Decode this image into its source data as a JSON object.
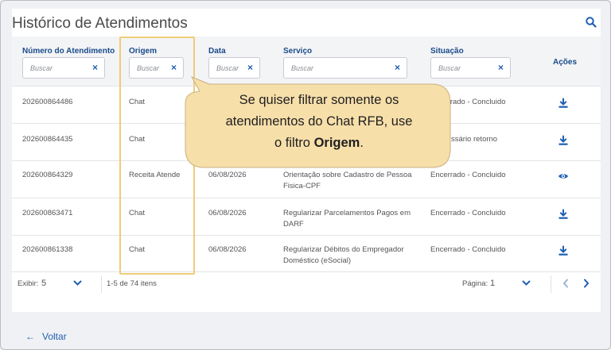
{
  "page": {
    "title": "Histórico de Atendimentos",
    "back_label": "Voltar",
    "back_icon": "arrow-left-icon",
    "search_icon": "search-icon"
  },
  "columns": [
    {
      "label": "Número do Atendimento",
      "placeholder": "Buscar"
    },
    {
      "label": "Origem",
      "placeholder": "Buscar"
    },
    {
      "label": "Data",
      "placeholder": "Buscar"
    },
    {
      "label": "Serviço",
      "placeholder": "Buscar"
    },
    {
      "label": "Situação",
      "placeholder": "Buscar"
    },
    {
      "label": "Ações"
    }
  ],
  "clear_glyph": "×",
  "rows": [
    {
      "numero": "202600864486",
      "origem": "Chat",
      "data": "",
      "servico": "",
      "situacao": "Encerrado - Concluido",
      "acao": "download-icon"
    },
    {
      "numero": "202600864435",
      "origem": "Chat",
      "data": "",
      "servico": "",
      "situacao": "ssário retorno",
      "acao": "download-icon"
    },
    {
      "numero": "202600864329",
      "origem": "Receita Atende",
      "data": "06/08/2026",
      "servico": "Orientação sobre Cadastro de Pessoa Fisica-CPF",
      "situacao": "Encerrado - Concluido",
      "acao": "eye-icon"
    },
    {
      "numero": "202600863471",
      "origem": "Chat",
      "data": "06/08/2026",
      "servico": "Regularizar Parcelamentos Pagos em DARF",
      "situacao": "Encerrado - Concluido",
      "acao": "download-icon"
    },
    {
      "numero": "202600861338",
      "origem": "Chat",
      "data": "06/08/2026",
      "servico": "Regularizar Débitos do Empregador Doméstico (eSocial)",
      "situacao": "Encerrado - Concluido",
      "acao": "download-icon"
    }
  ],
  "footer": {
    "exibir_label": "Exibir:",
    "exibir_value": "5",
    "range_text": "1-5 de 74 itens",
    "pagina_label": "Página:",
    "pagina_value": "1"
  },
  "callout": {
    "line1": "Se quiser filtrar somente os",
    "line2": "atendimentos do Chat RFB, use",
    "line3_prefix": "o filtro ",
    "line3_bold": "Origem",
    "line3_suffix": "."
  },
  "colors": {
    "accent": "#1f5fb4",
    "header_text": "#1a4b8a",
    "callout_fill": "#f7dfaa",
    "highlight_border": "#f0cc78"
  }
}
